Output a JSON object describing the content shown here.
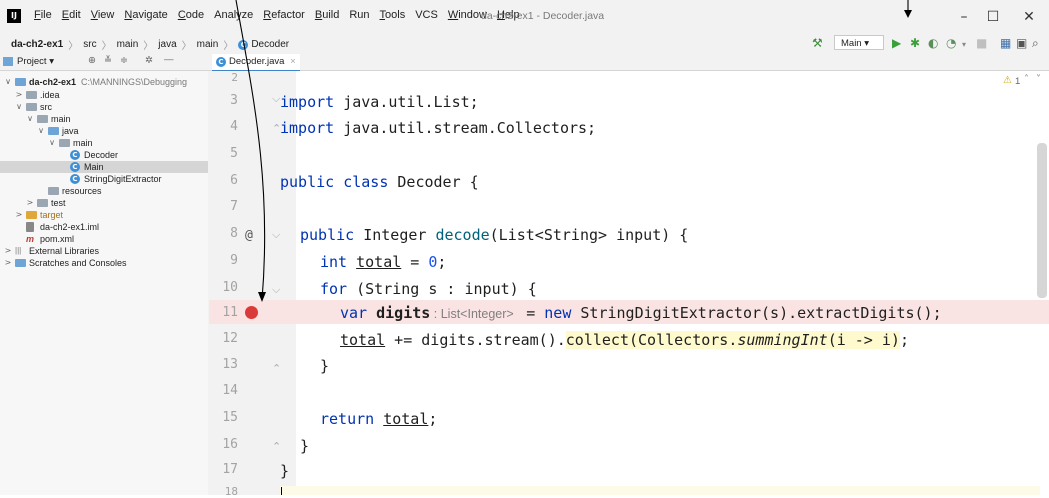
{
  "menubar": {
    "logo": "IJ",
    "items": [
      "File",
      "Edit",
      "View",
      "Navigate",
      "Code",
      "Analyze",
      "Refactor",
      "Build",
      "Run",
      "Tools",
      "VCS",
      "Window",
      "Help"
    ],
    "window_title": "da-ch2-ex1 - Decoder.java"
  },
  "navbar": {
    "crumbs": [
      "da-ch2-ex1",
      "src",
      "main",
      "java",
      "main",
      "Decoder"
    ],
    "run_config": "Main"
  },
  "project_panel": {
    "label": "Project"
  },
  "editor_tab": {
    "label": "Decoder.java",
    "close": "×"
  },
  "inspection": {
    "count": "1"
  },
  "tree": [
    {
      "label": "da-ch2-ex1",
      "extra": "C:\\MANNINGS\\Debugging",
      "depth": 0,
      "arrow": "∨",
      "icon": "folder-blue",
      "bold": true
    },
    {
      "label": ".idea",
      "depth": 1,
      "arrow": ">",
      "icon": "folder"
    },
    {
      "label": "src",
      "depth": 1,
      "arrow": "∨",
      "icon": "folder"
    },
    {
      "label": "main",
      "depth": 2,
      "arrow": "∨",
      "icon": "folder"
    },
    {
      "label": "java",
      "depth": 3,
      "arrow": "∨",
      "icon": "folder-blue"
    },
    {
      "label": "main",
      "depth": 4,
      "arrow": "∨",
      "icon": "folder"
    },
    {
      "label": "Decoder",
      "depth": 5,
      "arrow": "",
      "icon": "class"
    },
    {
      "label": "Main",
      "depth": 5,
      "arrow": "",
      "icon": "class",
      "selected": true
    },
    {
      "label": "StringDigitExtractor",
      "depth": 5,
      "arrow": "",
      "icon": "class"
    },
    {
      "label": "resources",
      "depth": 3,
      "arrow": "",
      "icon": "folder"
    },
    {
      "label": "test",
      "depth": 2,
      "arrow": ">",
      "icon": "folder"
    },
    {
      "label": "target",
      "depth": 1,
      "arrow": ">",
      "icon": "folder-orange"
    },
    {
      "label": "da-ch2-ex1.iml",
      "depth": 1,
      "arrow": "",
      "icon": "file"
    },
    {
      "label": "pom.xml",
      "depth": 1,
      "arrow": "",
      "icon": "maven"
    },
    {
      "label": "External Libraries",
      "depth": 0,
      "arrow": ">",
      "icon": "libs"
    },
    {
      "label": "Scratches and Consoles",
      "depth": 0,
      "arrow": ">",
      "icon": "scratch"
    }
  ],
  "code": {
    "line_numbers": [
      "2",
      "3",
      "4",
      "5",
      "6",
      "7",
      "8",
      "9",
      "10",
      "11",
      "12",
      "13",
      "14",
      "15",
      "16",
      "17",
      "18"
    ],
    "override_marker": "@",
    "l3_kw": "import",
    "l3_rest": " java.util.List;",
    "l4_kw": "import",
    "l4_rest": " java.util.stream.Collectors;",
    "l6_kw": "public class",
    "l6_rest": " Decoder {",
    "l8_kw": "public",
    "l8_type": " Integer ",
    "l8_fn": "decode",
    "l8_rest": "(List<String> input) {",
    "l9_kw": "int ",
    "l9_var": "total",
    "l9_eq": " = ",
    "l9_num": "0",
    "l9_end": ";",
    "l10_kw": "for",
    "l10_rest": " (String s : input) {",
    "l11_kw": "var ",
    "l11_var": "digits",
    "l11_hint": " : List<Integer> ",
    "l11_eq": " = ",
    "l11_new": "new",
    "l11_rest": " StringDigitExtractor(s).extractDigits();",
    "l12_var": "total",
    "l12_mid": " += digits.stream().",
    "l12_hl1": "collect(Collectors.",
    "l12_it": "summingInt",
    "l12_hl2": "(i -> i)",
    "l12_end": ";",
    "l13": "}",
    "l15_kw": "return ",
    "l15_var": "total",
    "l15_end": ";",
    "l16": "}",
    "l17": "}"
  }
}
